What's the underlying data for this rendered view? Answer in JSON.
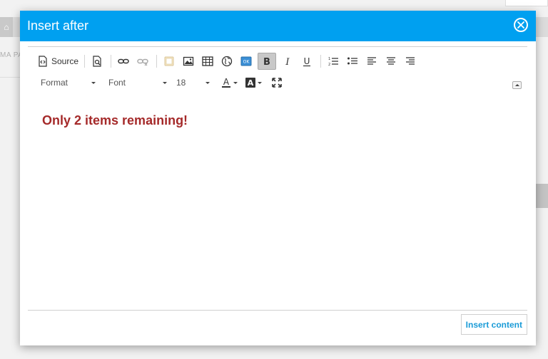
{
  "background": {
    "breadcrumb": "MA PA"
  },
  "dialog": {
    "title": "Insert after",
    "close_icon": "close-circle-icon",
    "insert_button_label": "Insert content"
  },
  "toolbar": {
    "source_label": "Source",
    "format_label": "Format",
    "font_label": "Font",
    "size_label": "18",
    "icons": [
      "source-icon",
      "preview-icon",
      "link-icon",
      "unlink-icon",
      "flash-icon",
      "image-icon",
      "table-icon",
      "globe-icon",
      "button-icon",
      "bold-icon",
      "italic-icon",
      "underline-icon",
      "numbered-list-icon",
      "bullet-list-icon",
      "align-left-icon",
      "align-center-icon",
      "align-right-icon",
      "text-color-icon",
      "background-color-icon",
      "maximize-icon"
    ]
  },
  "editor": {
    "content_text": "Only 2 items remaining!",
    "content_color": "#a52a2a"
  },
  "colors": {
    "header": "#00a0f0",
    "accent": "#1a9bd7"
  }
}
